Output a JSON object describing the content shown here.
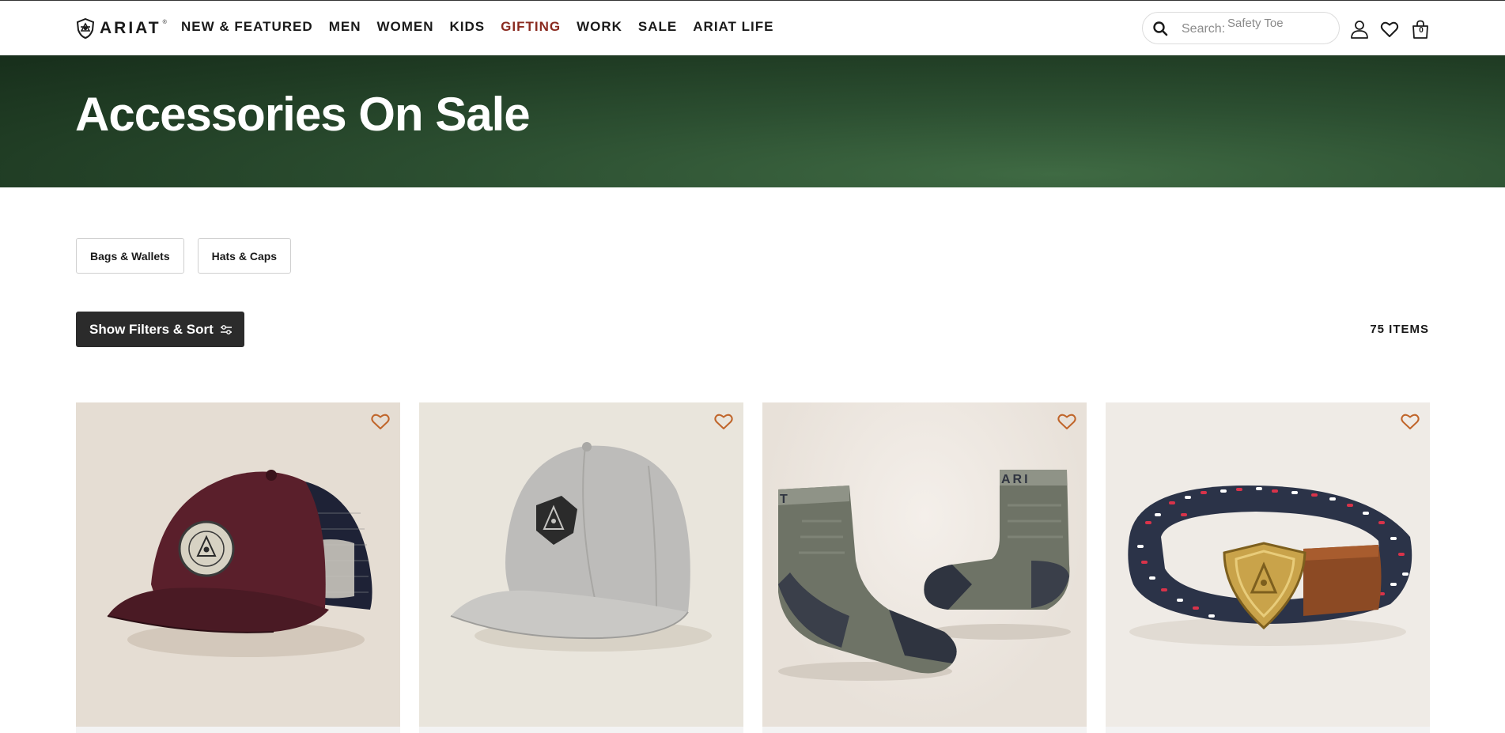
{
  "brand": {
    "logo_text": "ARIAT",
    "logo_reg": "®"
  },
  "nav": {
    "items": [
      {
        "label": "NEW & FEATURED"
      },
      {
        "label": "MEN"
      },
      {
        "label": "WOMEN"
      },
      {
        "label": "KIDS"
      },
      {
        "label": "GIFTING",
        "highlight": true
      },
      {
        "label": "WORK"
      },
      {
        "label": "SALE"
      },
      {
        "label": "ARIAT LIFE"
      }
    ],
    "highlight_color": "#8a2a1f"
  },
  "search": {
    "label": "Search:",
    "placeholder": "Safety Toe"
  },
  "header_icons": {
    "account": "user-icon",
    "wishlist": "heart-icon",
    "bag": "shopping-bag-icon",
    "bag_count": "0"
  },
  "hero": {
    "title": "Accessories On Sale",
    "background_color": "#2c4f31"
  },
  "categories": [
    {
      "label": "Bags & Wallets"
    },
    {
      "label": "Hats & Caps"
    }
  ],
  "toolbar": {
    "filter_label": "Show Filters & Sort",
    "filter_icon": "sliders-icon",
    "items_count": "75 ITEMS"
  },
  "products": [
    {
      "name": "burgundy-trucker-cap",
      "wishlist_icon": "heart-outline-icon"
    },
    {
      "name": "grey-wool-cap",
      "wishlist_icon": "heart-outline-icon"
    },
    {
      "name": "grey-crew-socks",
      "wishlist_icon": "heart-outline-icon"
    },
    {
      "name": "braided-belt",
      "wishlist_icon": "heart-outline-icon"
    }
  ],
  "colors": {
    "accent_heart": "#c0652a",
    "button_dark": "#2b2b2b"
  }
}
